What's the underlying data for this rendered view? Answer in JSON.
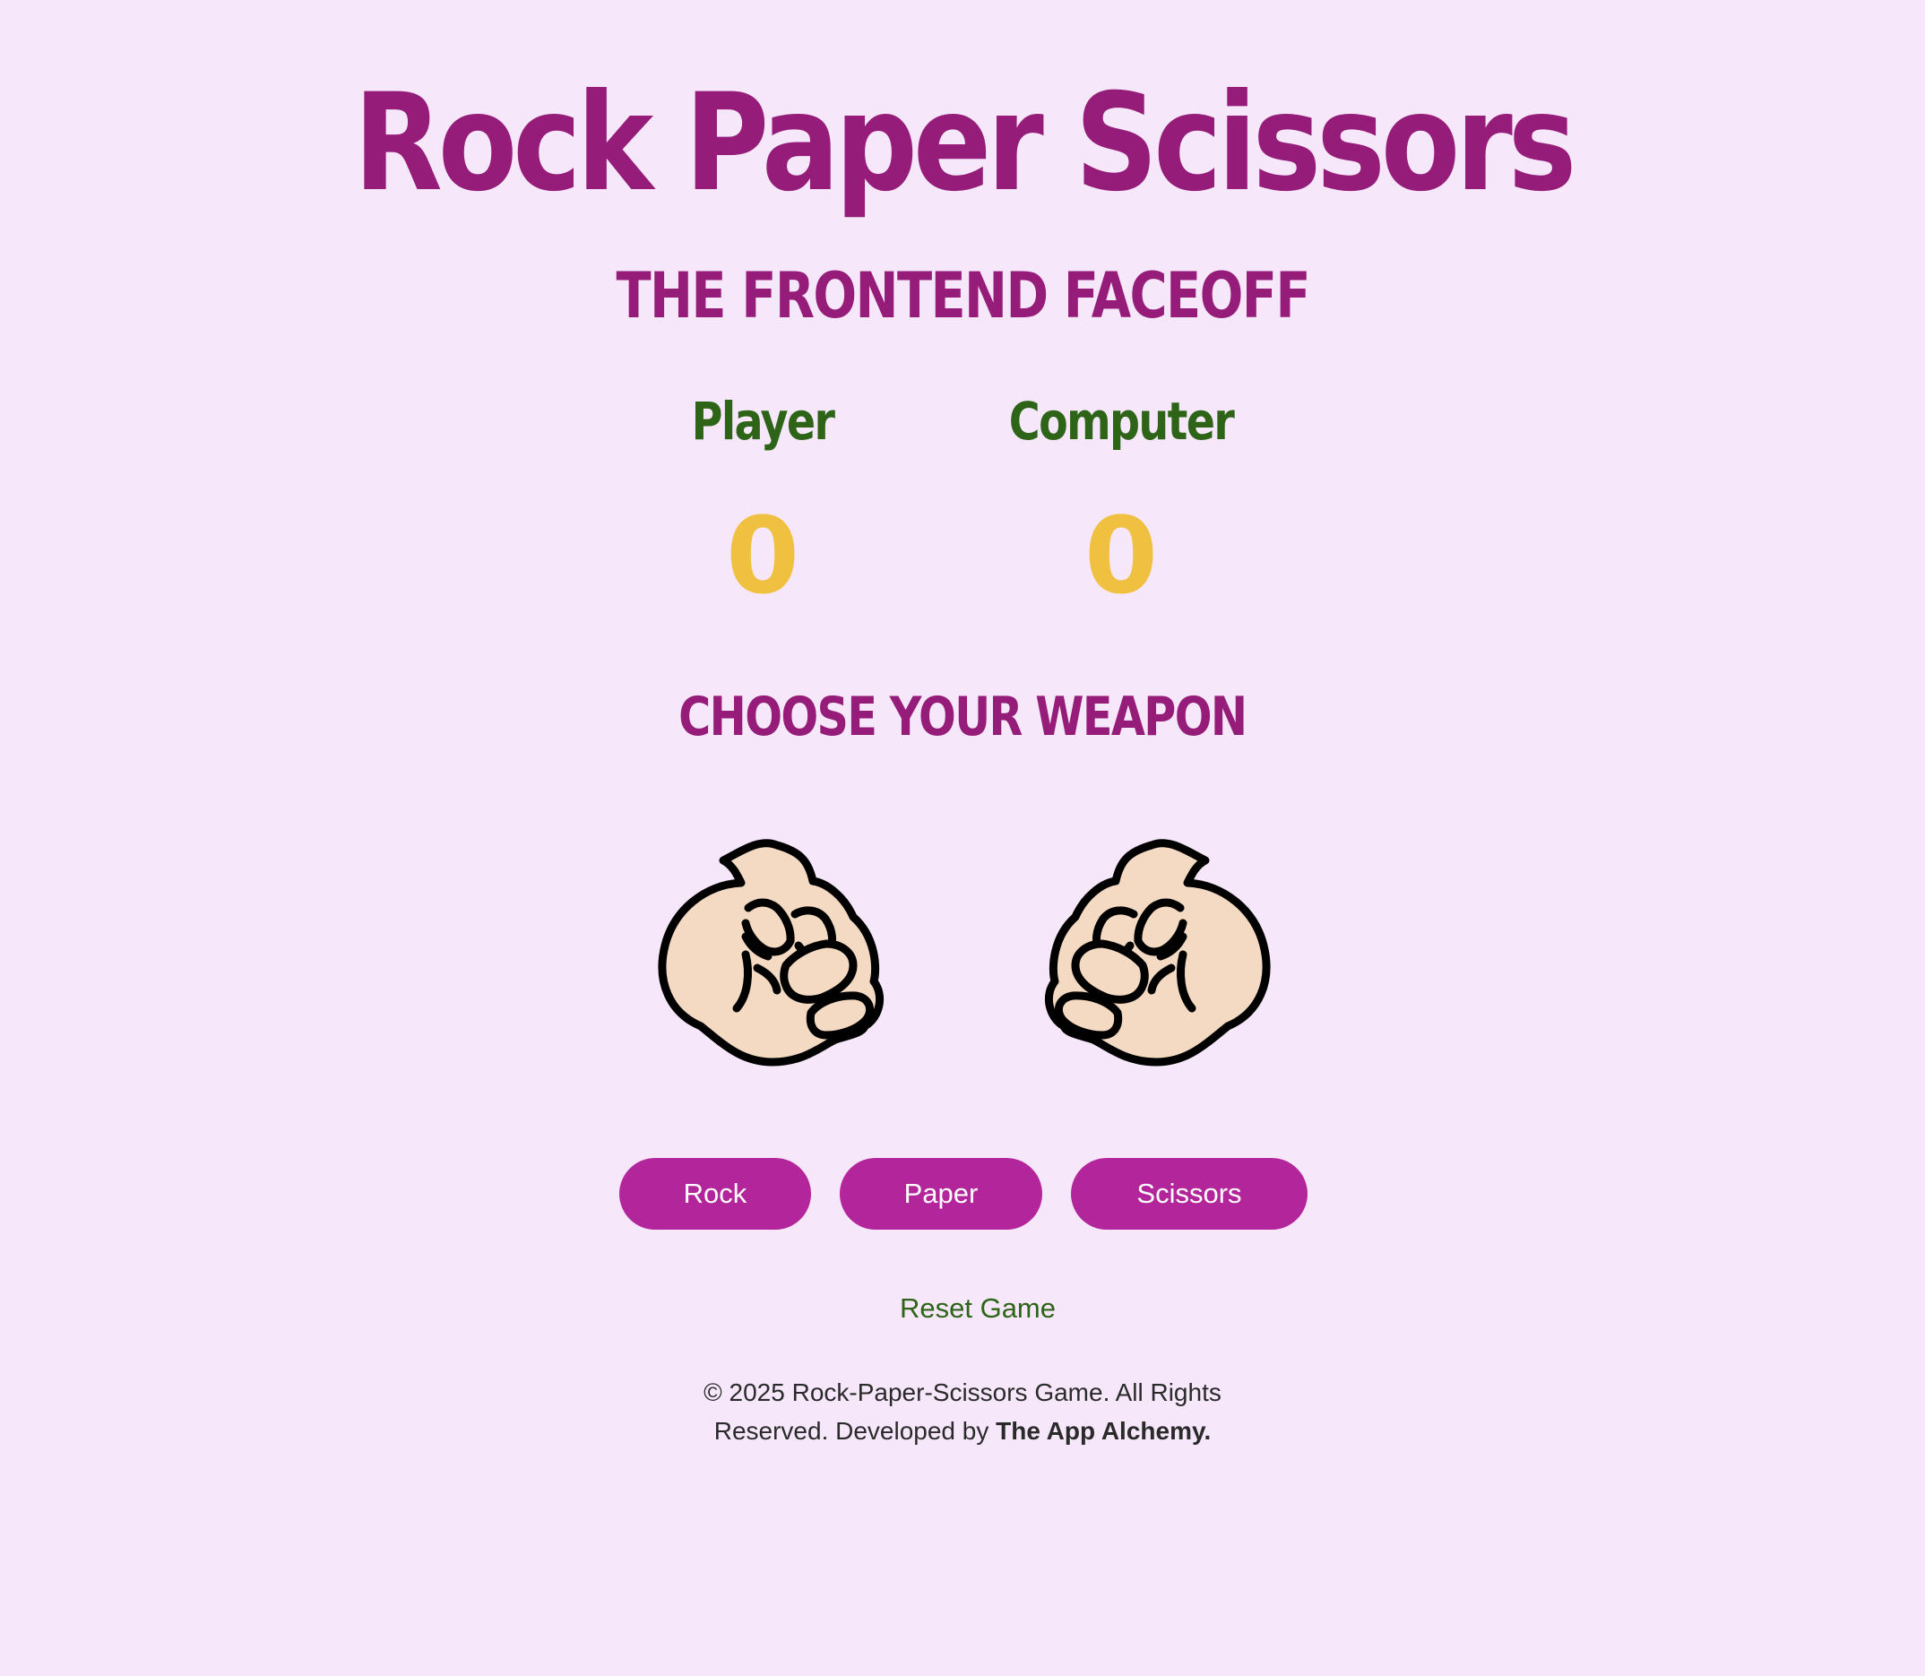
{
  "header": {
    "title": "Rock Paper Scissors",
    "subtitle": "THE FRONTEND FACEOFF"
  },
  "scoreboard": {
    "player_label": "Player",
    "player_score": "0",
    "computer_label": "Computer",
    "computer_score": "0"
  },
  "weapons": {
    "heading": "CHOOSE YOUR WEAPON",
    "player_hand_icon": "fist-icon",
    "computer_hand_icon": "fist-icon",
    "buttons": {
      "rock": "Rock",
      "paper": "Paper",
      "scissors": "Scissors"
    }
  },
  "reset_label": "Reset Game",
  "footer": {
    "line1": "© 2025 Rock-Paper-Scissors Game. All Rights",
    "line2_prefix": "Reserved. Developed by",
    "developer": "The App Alchemy."
  },
  "colors": {
    "background": "#f6e8fa",
    "title": "#951c79",
    "label_green": "#2e6418",
    "score_yellow": "#f0c040",
    "button": "#b3259a",
    "skin": "#f5dac3"
  }
}
